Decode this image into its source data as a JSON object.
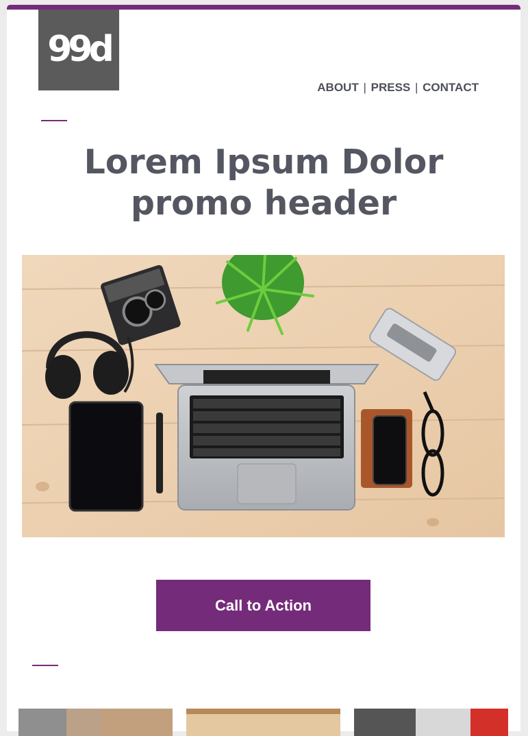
{
  "brand": {
    "logo_text": "99d"
  },
  "nav": {
    "about": "ABOUT",
    "press": "PRESS",
    "contact": "CONTACT",
    "separator": "|"
  },
  "headline": {
    "line1": "Lorem Ipsum Dolor",
    "line2": "promo header"
  },
  "hero": {
    "image": "desk-flatlay-laptop-camera-headphones-tablet-phone-glasses"
  },
  "cta": {
    "label": "Call to Action"
  },
  "colors": {
    "accent": "#742b7a",
    "heading": "#545661",
    "logo_bg": "#5b5b5b"
  }
}
